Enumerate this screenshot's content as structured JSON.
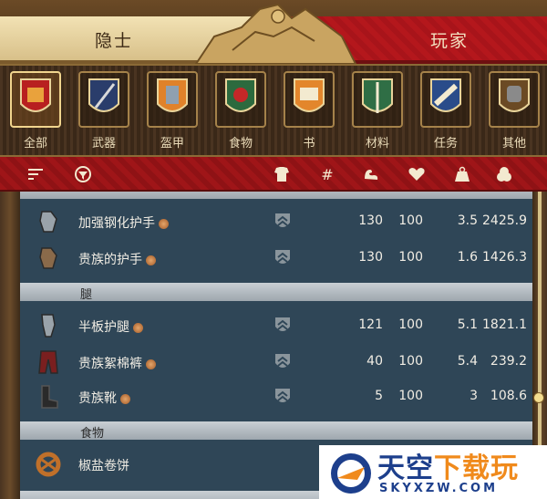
{
  "tabs": {
    "left_label": "隐士",
    "right_label": "玩家"
  },
  "categories": [
    {
      "label": "全部",
      "icon": "all-items-icon",
      "active": true
    },
    {
      "label": "武器",
      "icon": "weapon-icon"
    },
    {
      "label": "盔甲",
      "icon": "armor-icon"
    },
    {
      "label": "食物",
      "icon": "food-icon"
    },
    {
      "label": "书",
      "icon": "book-icon"
    },
    {
      "label": "材料",
      "icon": "material-icon"
    },
    {
      "label": "任务",
      "icon": "quest-icon"
    },
    {
      "label": "其他",
      "icon": "other-icon"
    }
  ],
  "columns": [
    "sort-icon",
    "filter-icon",
    "armor-type-icon",
    "quantity-icon",
    "strength-icon",
    "condition-icon",
    "weight-icon",
    "price-icon"
  ],
  "sections": [
    {
      "label": "腿"
    },
    {
      "label": "食物"
    }
  ],
  "rows": [
    {
      "name": "加强钢化护手",
      "icon": "gauntlet-icon",
      "v1": "130",
      "v2": "100",
      "v3": "3.5",
      "v4": "2425.9"
    },
    {
      "name": "贵族的护手",
      "icon": "gauntlet-icon",
      "v1": "130",
      "v2": "100",
      "v3": "1.6",
      "v4": "1426.3"
    },
    {
      "name": "半板护腿",
      "icon": "leg-armor-icon",
      "v1": "121",
      "v2": "100",
      "v3": "5.1",
      "v4": "1821.1"
    },
    {
      "name": "贵族絮棉裤",
      "icon": "pants-icon",
      "v1": "40",
      "v2": "100",
      "v3": "5.4",
      "v4": "239.2"
    },
    {
      "name": "贵族靴",
      "icon": "boots-icon",
      "v1": "5",
      "v2": "100",
      "v3": "3",
      "v4": "108.6"
    },
    {
      "name": "椒盐卷饼",
      "icon": "pretzel-icon"
    }
  ],
  "watermark": {
    "title_main": "天空",
    "title_accent": "下载玩",
    "url": "SKYXZW.COM"
  },
  "colors": {
    "accent_red": "#a8141a",
    "panel_blue": "#2f4657",
    "parchment": "#e6d2a0"
  }
}
